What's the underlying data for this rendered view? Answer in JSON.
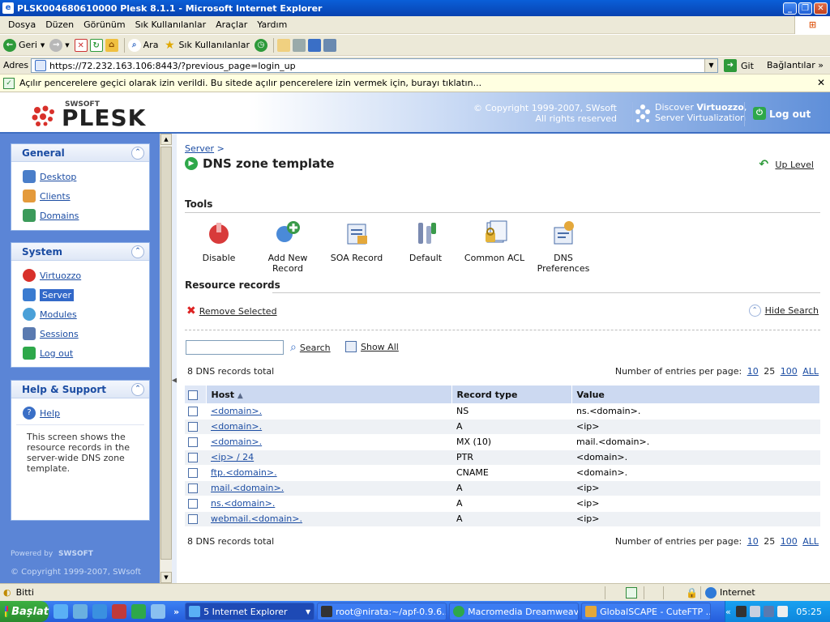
{
  "window": {
    "title": "PLSK004680610000 Plesk 8.1.1 - Microsoft Internet Explorer",
    "min": "_",
    "max": "❐",
    "close": "✕"
  },
  "menu": [
    "Dosya",
    "Düzen",
    "Görünüm",
    "Sık Kullanılanlar",
    "Araçlar",
    "Yardım"
  ],
  "toolbar": {
    "back": "Geri",
    "search": "Ara",
    "favorites": "Sık Kullanılanlar"
  },
  "address": {
    "label": "Adres",
    "url": "https://72.232.163.106:8443/?previous_page=login_up",
    "go": "Git",
    "links": "Bağlantılar",
    "more": "»"
  },
  "infobar": {
    "text": "Açılır pencerelere geçici olarak izin verildi. Bu sitede açılır pencerelere izin vermek için, burayı tıklatın...",
    "close": "✕"
  },
  "header": {
    "brand_small": "SWSOFT",
    "brand": "PLESK",
    "copyright_line1": "© Copyright 1999-2007, SWsoft",
    "copyright_line2": "All rights reserved",
    "discover_prefix": "Discover ",
    "discover_bold": "Virtuozzo",
    "discover_suffix": ",",
    "discover_line2": "Server Virtualization",
    "logout": "Log out"
  },
  "sidebar": {
    "general": {
      "title": "General",
      "items": [
        {
          "label": "Desktop",
          "icon": "desktop-icon",
          "color": "#4a7ec9"
        },
        {
          "label": "Clients",
          "icon": "clients-icon",
          "color": "#e49a3b"
        },
        {
          "label": "Domains",
          "icon": "domains-icon",
          "color": "#3b9a5a"
        }
      ]
    },
    "system": {
      "title": "System",
      "items": [
        {
          "label": "Virtuozzo",
          "icon": "virtuozzo-icon",
          "color": "#d8302a"
        },
        {
          "label": "Server",
          "icon": "server-icon",
          "color": "#3a7bd0"
        },
        {
          "label": "Modules",
          "icon": "modules-icon",
          "color": "#4aa0d8"
        },
        {
          "label": "Sessions",
          "icon": "sessions-icon",
          "color": "#5a7ab0"
        },
        {
          "label": "Log out",
          "icon": "logout-icon",
          "color": "#2ea84a"
        }
      ]
    },
    "help": {
      "title": "Help & Support",
      "items": [
        {
          "label": "Help",
          "icon": "help-icon",
          "color": "#3a6fc6"
        }
      ],
      "text": "This screen shows the resource records in the server-wide DNS zone template."
    },
    "powered": "Powered by",
    "powered_brand": "SWSOFT",
    "copyright": "© Copyright 1999-2007, SWsoft"
  },
  "main": {
    "breadcrumb_link": "Server",
    "breadcrumb_sep": ">",
    "title": "DNS zone template",
    "up_level": "Up Level",
    "tools_title": "Tools",
    "tools": [
      {
        "label": "Disable",
        "icon": "disable-icon",
        "color": "#d83a3a"
      },
      {
        "label": "Add New Record",
        "icon": "add-record-icon",
        "color": "#3a9a4a"
      },
      {
        "label": "SOA Record",
        "icon": "soa-record-icon",
        "color": "#e4a83b"
      },
      {
        "label": "Default",
        "icon": "default-icon",
        "color": "#7a8ab0"
      },
      {
        "label": "Common ACL",
        "icon": "common-acl-icon",
        "color": "#e4b43b"
      },
      {
        "label": "DNS Preferences",
        "icon": "dns-preferences-icon",
        "color": "#4a8ad8"
      }
    ],
    "records_title": "Resource records",
    "remove_selected": "Remove Selected",
    "hide_search": "Hide Search",
    "search_value": "",
    "search_button": "Search",
    "show_all": "Show All",
    "total": "8 DNS records total",
    "per_page_label": "Number of entries per page:",
    "per_page_options": [
      "10",
      "25",
      "100",
      "ALL"
    ],
    "columns": [
      "Host",
      "Record type",
      "Value"
    ],
    "sort_indicator": "▲",
    "rows": [
      {
        "host": "<domain>.",
        "type": "NS",
        "value": "ns.<domain>."
      },
      {
        "host": "<domain>.",
        "type": "A",
        "value": "<ip>"
      },
      {
        "host": "<domain>.",
        "type": "MX (10)",
        "value": "mail.<domain>."
      },
      {
        "host": "<ip> / 24",
        "type": "PTR",
        "value": "<domain>."
      },
      {
        "host": "ftp.<domain>.",
        "type": "CNAME",
        "value": "<domain>."
      },
      {
        "host": "mail.<domain>.",
        "type": "A",
        "value": "<ip>"
      },
      {
        "host": "ns.<domain>.",
        "type": "A",
        "value": "<ip>"
      },
      {
        "host": "webmail.<domain>.",
        "type": "A",
        "value": "<ip>"
      }
    ]
  },
  "status": {
    "text": "Bitti",
    "zone": "Internet"
  },
  "taskbar": {
    "start": "Başlat",
    "more": "»",
    "tasks": [
      {
        "label": "5 Internet Explorer",
        "active": true,
        "color": "#5ab0f5"
      },
      {
        "label": "root@nirata:~/apf-0.9.6...",
        "active": false,
        "color": "#333"
      },
      {
        "label": "Macromedia Dreamweav...",
        "active": false,
        "color": "#2ea84a"
      },
      {
        "label": "GlobalSCAPE - CuteFTP ...",
        "active": false,
        "color": "#e4a83b"
      }
    ],
    "tray_more": "«",
    "time": "05:25"
  },
  "colors": {
    "accent": "#3369c9",
    "sidebar_bg": "#5b85d6",
    "link": "#1c4da3"
  }
}
